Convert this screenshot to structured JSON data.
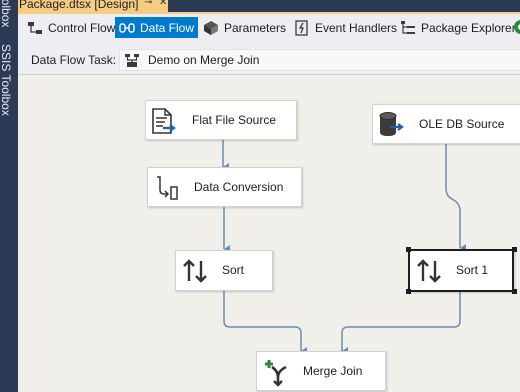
{
  "side_panel": {
    "items": [
      {
        "label": "SSIS Toolbox"
      },
      {
        "label": "oolbox"
      }
    ]
  },
  "document_tab": {
    "title": "Package.dtsx [Design]",
    "pin_glyph": "⊸",
    "close_glyph": "✕"
  },
  "designer_tabs": [
    {
      "label": "Control Flow",
      "icon": "control-flow-icon",
      "active": false
    },
    {
      "label": "Data Flow",
      "icon": "data-flow-icon",
      "active": true
    },
    {
      "label": "Parameters",
      "icon": "parameters-icon",
      "active": false
    },
    {
      "label": "Event Handlers",
      "icon": "event-handlers-icon",
      "active": false
    },
    {
      "label": "Package Explorer",
      "icon": "package-explorer-icon",
      "active": false
    }
  ],
  "task_bar": {
    "label": "Data Flow Task:",
    "selected_task": "Demo on Merge Join"
  },
  "components": [
    {
      "label": "Flat File Source",
      "icon": "flat-file-source-icon",
      "selected": false
    },
    {
      "label": "OLE DB Source",
      "icon": "ole-db-source-icon",
      "selected": false
    },
    {
      "label": "Data Conversion",
      "icon": "data-conversion-icon",
      "selected": false
    },
    {
      "label": "Sort",
      "icon": "sort-icon",
      "selected": false
    },
    {
      "label": "Sort 1",
      "icon": "sort-icon",
      "selected": true
    },
    {
      "label": "Merge Join",
      "icon": "merge-join-icon",
      "selected": false
    }
  ],
  "colors": {
    "accent": "#007acc",
    "tab_highlight": "#f5cc84",
    "side_panel": "#2b3a55",
    "canvas": "#f1efe9",
    "connector": "#6b8cb5"
  }
}
